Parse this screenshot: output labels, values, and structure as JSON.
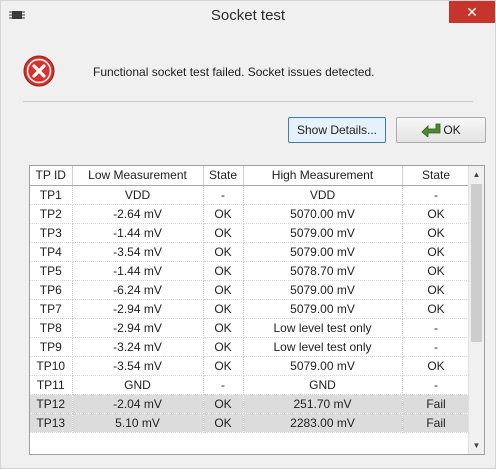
{
  "window": {
    "title": "Socket test",
    "close_label": "✕",
    "app_icon": "chip-icon"
  },
  "message": {
    "icon": "error-icon",
    "text": "Functional socket test failed. Socket issues detected."
  },
  "buttons": {
    "details_label": "Show Details...",
    "ok_label": "OK"
  },
  "table": {
    "columns": [
      "TP ID",
      "Low Measurement",
      "State",
      "High Measurement",
      "State"
    ],
    "rows": [
      [
        "TP1",
        "VDD",
        "-",
        "VDD",
        "-"
      ],
      [
        "TP2",
        "-2.64 mV",
        "OK",
        "5070.00 mV",
        "OK"
      ],
      [
        "TP3",
        "-1.44 mV",
        "OK",
        "5079.00 mV",
        "OK"
      ],
      [
        "TP4",
        "-3.54 mV",
        "OK",
        "5079.00 mV",
        "OK"
      ],
      [
        "TP5",
        "-1.44 mV",
        "OK",
        "5078.70 mV",
        "OK"
      ],
      [
        "TP6",
        "-6.24 mV",
        "OK",
        "5079.00 mV",
        "OK"
      ],
      [
        "TP7",
        "-2.94 mV",
        "OK",
        "5079.00 mV",
        "OK"
      ],
      [
        "TP8",
        "-2.94 mV",
        "OK",
        "Low level test only",
        "-"
      ],
      [
        "TP9",
        "-3.24 mV",
        "OK",
        "Low level test only",
        "-"
      ],
      [
        "TP10",
        "-3.54 mV",
        "OK",
        "5079.00 mV",
        "OK"
      ],
      [
        "TP11",
        "GND",
        "-",
        "GND",
        "-"
      ],
      [
        "TP12",
        "-2.04 mV",
        "OK",
        "251.70 mV",
        "Fail"
      ],
      [
        "TP13",
        "5.10 mV",
        "OK",
        "2283.00 mV",
        "Fail"
      ]
    ],
    "failed_rows": [
      "TP12",
      "TP13"
    ]
  },
  "colors": {
    "close_button": "#c7342b",
    "error_icon": "#d9312b",
    "ok_arrow": "#4f8a2e",
    "fail_row": "#dcdcdc"
  }
}
